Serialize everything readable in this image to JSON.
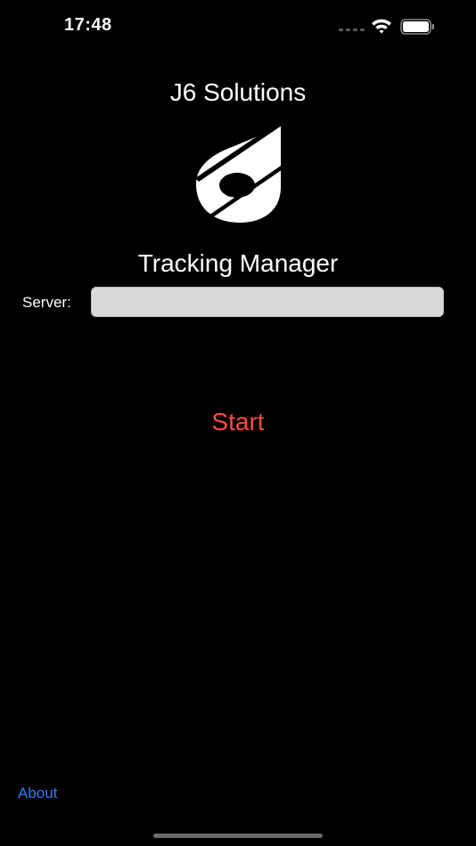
{
  "status_bar": {
    "time": "17:48",
    "icons": [
      "cell-signal-icon",
      "wifi-icon",
      "battery-icon"
    ]
  },
  "header": {
    "title": "J6 Solutions",
    "logo_icon": "j6-logo-icon",
    "subtitle": "Tracking Manager"
  },
  "form": {
    "server_label": "Server:",
    "server_value": "",
    "server_placeholder": ""
  },
  "actions": {
    "start_label": "Start",
    "start_color": "#ff4b3e"
  },
  "footer": {
    "about_label": "About",
    "about_color": "#2f7cf6"
  }
}
